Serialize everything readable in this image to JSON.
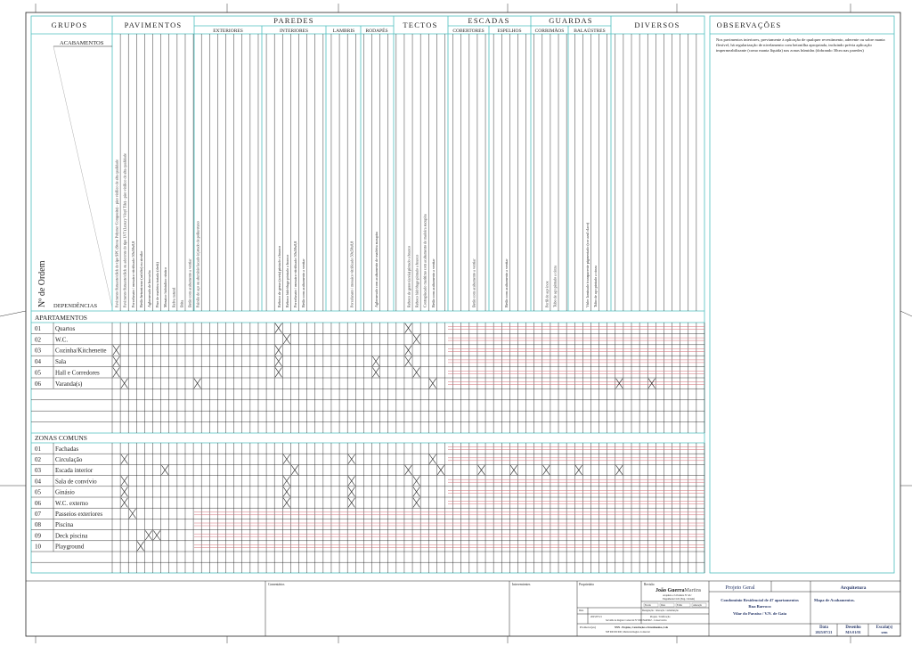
{
  "header": {
    "grupos": "GRUPOS",
    "pavimentos": "PAVIMENTOS",
    "paredes": "PAREDES",
    "tectos": "TECTOS",
    "escadas": "ESCADAS",
    "guardas": "GUARDAS",
    "diversos": "DIVERSOS",
    "observacoes": "OBSERVAÇÕES",
    "sub": {
      "exteriores": "EXTERIORES",
      "interiores": "INTERIORES",
      "lambris": "LAMBRIS",
      "rodapes": "RODAPÉS",
      "cobertores": "COBERTORES",
      "espelhos": "ESPELHOS",
      "corrimaos": "CORRIMÃOS",
      "balaustres": "BALAÚSTRES"
    },
    "acabamentos": "ACABAMENTOS",
    "n_ordem": "Nº de Ordem",
    "dependencias": "DEPENDÊNCIAS"
  },
  "observations_text": "Nos pavimentos interiores, previamente à aplicação de qualquer revestimento, aderente ou sobre manta flexível, há regularização de nivelamento com betonilha apropriada, incluindo prévia aplicação impermeabilizante (como manta líquida) nas zonas húmidas (dobrando 30cm nas paredes)",
  "finishes": {
    "pavimentos": [
      "Pavimento flutuante/click do tipo SPC (Stone Polymer Composite) - piso vinílico de alta qualidade",
      "Pavimento flutuante/click ou aderente do tipo LVT (Luxury Vinyl Tile) - piso vinílico de alta qualidade",
      "Porcelanato / mosaico vitrificado 50x50x0,8",
      "Betão betuminoso (asfalto) ou similar",
      "Aglomerado de borracha",
      "Piso de madeira tratada (deck)",
      "Mosaico hidráulico rústico",
      "Relva natural",
      "Brita",
      "Betão com acabamento a ventiar"
    ],
    "paredes_ext": [
      "Painéis de aço ou alumínio lacado injetado de poliuretano"
    ],
    "paredes_int": [
      "Reboco de gesso (areia) pintado a branco",
      "Reboco hidrófugo pintado a branco",
      "Porcelanato / mosaico vitrificado 50x50x0,8",
      "Betão com acabamento a ventiar"
    ],
    "lambris": [
      "Porcelanato / mosaico vitrificado 50x50x0,8"
    ],
    "rodapes": [
      "Aglomerado com acabamento de madeira sucupira"
    ],
    "tectos": [
      "Reboco de gesso (areia) pintado a branco",
      "Reboco hidrófugo pintado a branco",
      "Contraplacado marítimo com acabamento de madeira sucupira",
      "Betão com acabamento a ventiar"
    ],
    "cobertores": [
      "Betão com acabamento a ventiar"
    ],
    "espelhos": [
      "Betão com acabamento a ventiar"
    ],
    "corrimaos": [
      "Perfil de aço inox",
      "Tubo de aço pintado a cinza"
    ],
    "balaustres": [
      "Vidro laminado transparente pigmentado (cor azul claro)",
      "Tubo de aço pintado a cinza"
    ]
  },
  "apartamentos": {
    "title": "APARTAMENTOS",
    "rows": [
      {
        "n": "01",
        "name": "Quartos"
      },
      {
        "n": "02",
        "name": "W.C."
      },
      {
        "n": "03",
        "name": "Cozinha/Kitchenette"
      },
      {
        "n": "04",
        "name": "Sala"
      },
      {
        "n": "05",
        "name": "Hall e Corredores"
      },
      {
        "n": "06",
        "name": "Varanda(s)"
      }
    ]
  },
  "zonas_comuns": {
    "title": "ZONAS COMUNS",
    "rows": [
      {
        "n": "01",
        "name": "Fachadas"
      },
      {
        "n": "02",
        "name": "Circulação"
      },
      {
        "n": "03",
        "name": "Escada interior"
      },
      {
        "n": "04",
        "name": "Sala de convívio"
      },
      {
        "n": "05",
        "name": "Ginásio"
      },
      {
        "n": "06",
        "name": "W.C. externo"
      },
      {
        "n": "07",
        "name": "Passeios exteriores"
      },
      {
        "n": "08",
        "name": "Piscina"
      },
      {
        "n": "09",
        "name": "Deck piscina"
      },
      {
        "n": "10",
        "name": "Playground"
      }
    ]
  },
  "marks": {
    "apartamentos": [
      [
        0,
        20,
        36
      ],
      [
        1,
        21,
        37
      ],
      [
        2,
        0,
        20,
        36
      ],
      [
        3,
        0,
        20,
        32,
        36
      ],
      [
        4,
        0,
        20,
        32,
        37
      ],
      [
        5,
        1,
        10,
        39,
        62,
        66
      ]
    ],
    "zonas_comuns": [
      [
        1,
        1,
        21,
        29,
        39
      ],
      [
        2,
        6,
        22,
        36,
        40,
        45,
        49,
        53,
        57,
        62
      ],
      [
        3,
        1,
        21,
        29,
        37
      ],
      [
        4,
        1,
        21,
        29,
        37
      ],
      [
        5,
        1,
        21,
        29,
        37
      ],
      [
        6,
        2
      ],
      [
        8,
        4,
        5
      ],
      [
        9,
        3
      ]
    ]
  },
  "title_block": {
    "comentarios": "Comentários",
    "intervenientes": "Intervenientes",
    "proprietario": "Proprietário",
    "revisao": "Revisão",
    "author": "João Guerra",
    "author_tail": "Martins",
    "author_sub1": "Arquiteto e Urbanista Nº AU",
    "author_sub2": "Engenharia Civil (Eng.: Ordem)",
    "fields": [
      "Escala",
      "Data",
      "Folha",
      "Alteração"
    ],
    "data_label": "Data",
    "data_value": "2025/07/21",
    "coord_label": "Designação / alteração / substituição",
    "coord_value": "Projeto / Unificação",
    "promotor_label": "Promotor(es)",
    "promotor_line1": "NNN - Projetos, Construções e Investimentos, Lda",
    "promotor_line2": "NIF 000 000 000 | Matrícula Registo Comercial",
    "reg_line": "Servidão de Registo Comercial Nº 0000 MATRIZ - Conservatória",
    "projeto_geral": "Projeto Geral",
    "arquitetura": "Arquitetura",
    "proj_line1": "Condomínio Residencial de 47 apartamentos",
    "proj_line2": "Rua Barroco",
    "proj_line3": "Vilar do Paraíso / V.N. de Gaia",
    "drawing_title": "Mapa de Acabamentos.",
    "data_h": "Data",
    "data_v": "2025/07/21",
    "desenho_h": "Desenho",
    "desenho_v": "MA 01/01",
    "escala_h": "Escala(s)",
    "escala_v": "sem"
  },
  "colors": {
    "teal": "#4fbfbf",
    "red": "#c0393b",
    "pink": "#e29aa0",
    "navy": "#2a3a6a"
  }
}
